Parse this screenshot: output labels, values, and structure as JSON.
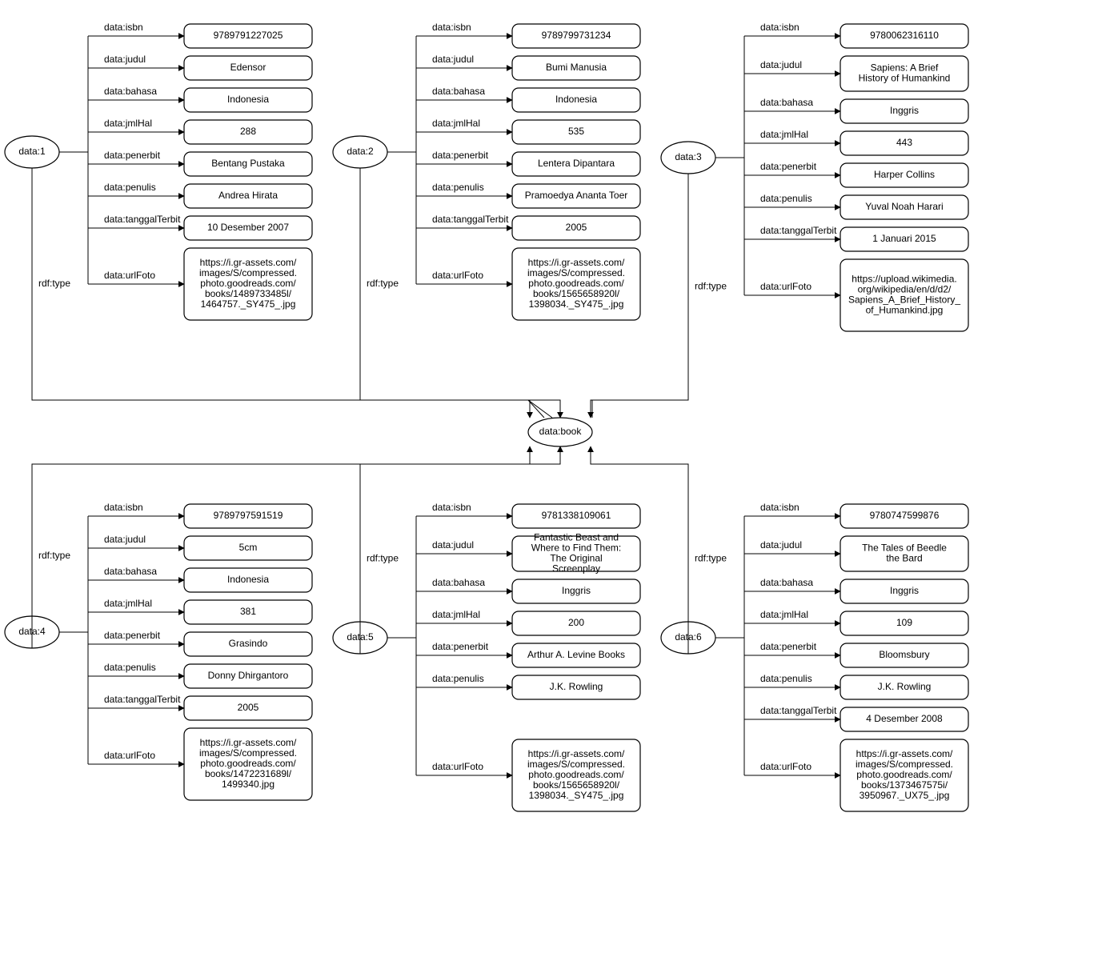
{
  "centerLabel": "data:book",
  "typeEdgeLabel": "rdf:type",
  "propLabels": {
    "isbn": "data:isbn",
    "judul": "data:judul",
    "bahasa": "data:bahasa",
    "jmlHal": "data:jmlHal",
    "penerbit": "data:penerbit",
    "penulis": "data:penulis",
    "tanggalTerbit": "data:tanggalTerbit",
    "urlFoto": "data:urlFoto"
  },
  "books": [
    {
      "id": "data:1",
      "isbn": "9789791227025",
      "judul": "Edensor",
      "bahasa": "Indonesia",
      "jmlHal": "288",
      "penerbit": "Bentang Pustaka",
      "penulis": "Andrea Hirata",
      "tanggalTerbit": "10 Desember 2007",
      "urlFoto": "https://i.gr-assets.com/images/S/compressed.photo.goodreads.com/books/1489733485l/1464757._SY475_.jpg"
    },
    {
      "id": "data:2",
      "isbn": "9789799731234",
      "judul": "Bumi Manusia",
      "bahasa": "Indonesia",
      "jmlHal": "535",
      "penerbit": "Lentera Dipantara",
      "penulis": "Pramoedya Ananta Toer",
      "tanggalTerbit": "2005",
      "urlFoto": "https://i.gr-assets.com/images/S/compressed.photo.goodreads.com/books/1565658920l/1398034._SY475_.jpg"
    },
    {
      "id": "data:3",
      "isbn": "9780062316110",
      "judul": "Sapiens: A Brief History of Humankind",
      "bahasa": "Inggris",
      "jmlHal": "443",
      "penerbit": "Harper Collins",
      "penulis": "Yuval Noah Harari",
      "tanggalTerbit": "1 Januari 2015",
      "urlFoto": "https://upload.wikimedia.org/wikipedia/en/d/d2/Sapiens_A_Brief_History_of_Humankind.jpg"
    },
    {
      "id": "data:4",
      "isbn": "9789797591519",
      "judul": "5cm",
      "bahasa": "Indonesia",
      "jmlHal": "381",
      "penerbit": "Grasindo",
      "penulis": "Donny Dhirgantoro",
      "tanggalTerbit": "2005",
      "urlFoto": "https://i.gr-assets.com/images/S/compressed.photo.goodreads.com/books/1472231689l/1499340.jpg"
    },
    {
      "id": "data:5",
      "isbn": "9781338109061",
      "judul": "Fantastic Beast and Where to Find Them: The Original Screenplay",
      "bahasa": "Inggris",
      "jmlHal": "200",
      "penerbit": "Arthur A. Levine Books",
      "penulis": "J.K. Rowling",
      "tanggalTerbit": "",
      "urlFoto": "https://i.gr-assets.com/images/S/compressed.photo.goodreads.com/books/1565658920l/1398034._SY475_.jpg"
    },
    {
      "id": "data:6",
      "isbn": "9780747599876",
      "judul": "The Tales of Beedle the Bard",
      "bahasa": "Inggris",
      "jmlHal": "109",
      "penerbit": "Bloomsbury",
      "penulis": "J.K. Rowling",
      "tanggalTerbit": "4 Desember 2008",
      "urlFoto": "https://i.gr-assets.com/images/S/compressed.photo.goodreads.com/books/1373467575i/3950967._UX75_.jpg"
    }
  ]
}
